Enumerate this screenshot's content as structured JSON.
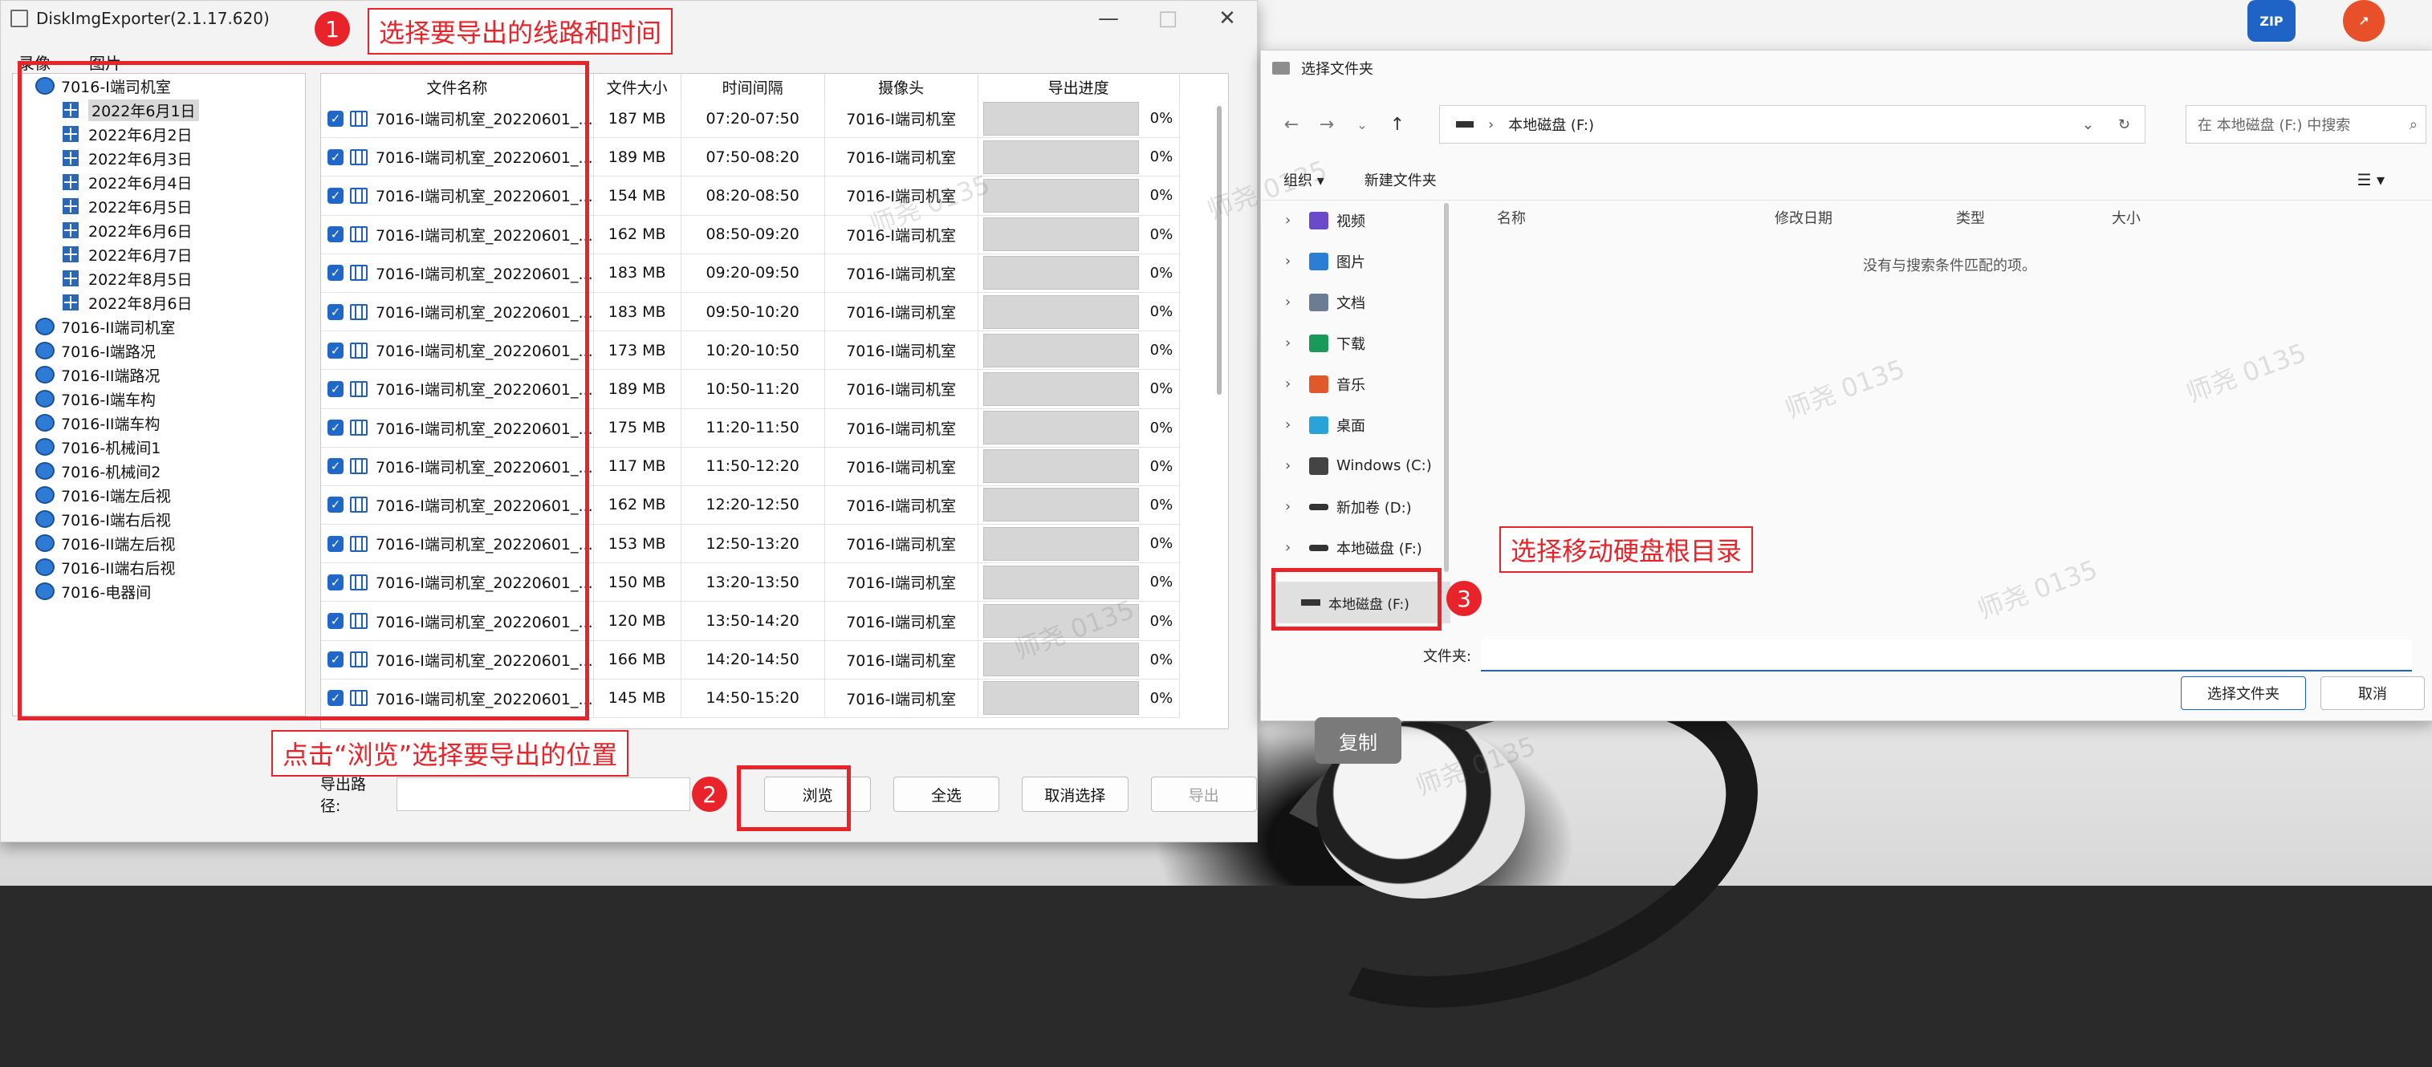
{
  "main_window": {
    "title": "DiskImgExporter(2.1.17.620)",
    "controls": [
      "—",
      "□",
      "✕"
    ],
    "menu": [
      "录像",
      "图片"
    ],
    "tree": {
      "root": "7016-I端司机室",
      "dates": [
        "2022年6月1日",
        "2022年6月2日",
        "2022年6月3日",
        "2022年6月4日",
        "2022年6月5日",
        "2022年6月6日",
        "2022年6月7日",
        "2022年8月5日",
        "2022年8月6日"
      ],
      "others": [
        "7016-II端司机室",
        "7016-I端路况",
        "7016-II端路况",
        "7016-I端车构",
        "7016-II端车构",
        "7016-机械间1",
        "7016-机械间2",
        "7016-I端左后视",
        "7016-I端右后视",
        "7016-II端左后视",
        "7016-II端右后视",
        "7016-电器间"
      ]
    },
    "columns": [
      "文件名称",
      "文件大小",
      "时间间隔",
      "摄像头",
      "导出进度"
    ],
    "rows": [
      {
        "name": "7016-I端司机室_20220601_...",
        "size": "187 MB",
        "time": "07:20-07:50",
        "camera": "7016-I端司机室",
        "progress": "0%"
      },
      {
        "name": "7016-I端司机室_20220601_...",
        "size": "189 MB",
        "time": "07:50-08:20",
        "camera": "7016-I端司机室",
        "progress": "0%"
      },
      {
        "name": "7016-I端司机室_20220601_...",
        "size": "154 MB",
        "time": "08:20-08:50",
        "camera": "7016-I端司机室",
        "progress": "0%"
      },
      {
        "name": "7016-I端司机室_20220601_...",
        "size": "162 MB",
        "time": "08:50-09:20",
        "camera": "7016-I端司机室",
        "progress": "0%"
      },
      {
        "name": "7016-I端司机室_20220601_...",
        "size": "183 MB",
        "time": "09:20-09:50",
        "camera": "7016-I端司机室",
        "progress": "0%"
      },
      {
        "name": "7016-I端司机室_20220601_...",
        "size": "183 MB",
        "time": "09:50-10:20",
        "camera": "7016-I端司机室",
        "progress": "0%"
      },
      {
        "name": "7016-I端司机室_20220601_...",
        "size": "173 MB",
        "time": "10:20-10:50",
        "camera": "7016-I端司机室",
        "progress": "0%"
      },
      {
        "name": "7016-I端司机室_20220601_...",
        "size": "189 MB",
        "time": "10:50-11:20",
        "camera": "7016-I端司机室",
        "progress": "0%"
      },
      {
        "name": "7016-I端司机室_20220601_...",
        "size": "175 MB",
        "time": "11:20-11:50",
        "camera": "7016-I端司机室",
        "progress": "0%"
      },
      {
        "name": "7016-I端司机室_20220601_...",
        "size": "117 MB",
        "time": "11:50-12:20",
        "camera": "7016-I端司机室",
        "progress": "0%"
      },
      {
        "name": "7016-I端司机室_20220601_...",
        "size": "162 MB",
        "time": "12:20-12:50",
        "camera": "7016-I端司机室",
        "progress": "0%"
      },
      {
        "name": "7016-I端司机室_20220601_...",
        "size": "153 MB",
        "time": "12:50-13:20",
        "camera": "7016-I端司机室",
        "progress": "0%"
      },
      {
        "name": "7016-I端司机室_20220601_...",
        "size": "150 MB",
        "time": "13:20-13:50",
        "camera": "7016-I端司机室",
        "progress": "0%"
      },
      {
        "name": "7016-I端司机室_20220601_...",
        "size": "120 MB",
        "time": "13:50-14:20",
        "camera": "7016-I端司机室",
        "progress": "0%"
      },
      {
        "name": "7016-I端司机室_20220601_...",
        "size": "166 MB",
        "time": "14:20-14:50",
        "camera": "7016-I端司机室",
        "progress": "0%"
      },
      {
        "name": "7016-I端司机室_20220601_...",
        "size": "145 MB",
        "time": "14:50-15:20",
        "camera": "7016-I端司机室",
        "progress": "0%"
      }
    ],
    "export_path_label": "导出路径:",
    "export_path_value": "",
    "buttons": {
      "browse": "浏览",
      "select_all": "全选",
      "deselect": "取消选择",
      "export": "导出"
    }
  },
  "folder_dialog": {
    "title": "选择文件夹",
    "address": "本地磁盘 (F:)",
    "search_placeholder": "在 本地磁盘 (F:) 中搜索",
    "organize": "组织 ▾",
    "new_folder": "新建文件夹",
    "nav": [
      "视频",
      "图片",
      "文档",
      "下载",
      "音乐",
      "桌面",
      "Windows (C:)",
      "新加卷 (D:)",
      "本地磁盘 (F:)"
    ],
    "nav_selected": "本地磁盘 (F:)",
    "columns": [
      "名称",
      "修改日期",
      "类型",
      "大小"
    ],
    "empty_message": "没有与搜索条件匹配的项。",
    "folder_label": "文件夹:",
    "folder_value": "",
    "select_button": "选择文件夹",
    "cancel_button": "取消"
  },
  "desktop": {
    "icons": [
      {
        "label": "",
        "badge": "ZIP",
        "color": "#1f63c6"
      },
      {
        "label": "",
        "badge": "↗",
        "color": "#e8502a"
      }
    ],
    "copy_button": "复制",
    "watermark": "师尧 0135"
  },
  "annotations": {
    "step1": {
      "num": "1",
      "text": "选择要导出的线路和时间"
    },
    "step2": {
      "num": "2",
      "text": "点击“浏览”选择要导出的位置"
    },
    "step3": {
      "num": "3",
      "text": "选择移动硬盘根目录"
    },
    "color": "#e8232a"
  }
}
